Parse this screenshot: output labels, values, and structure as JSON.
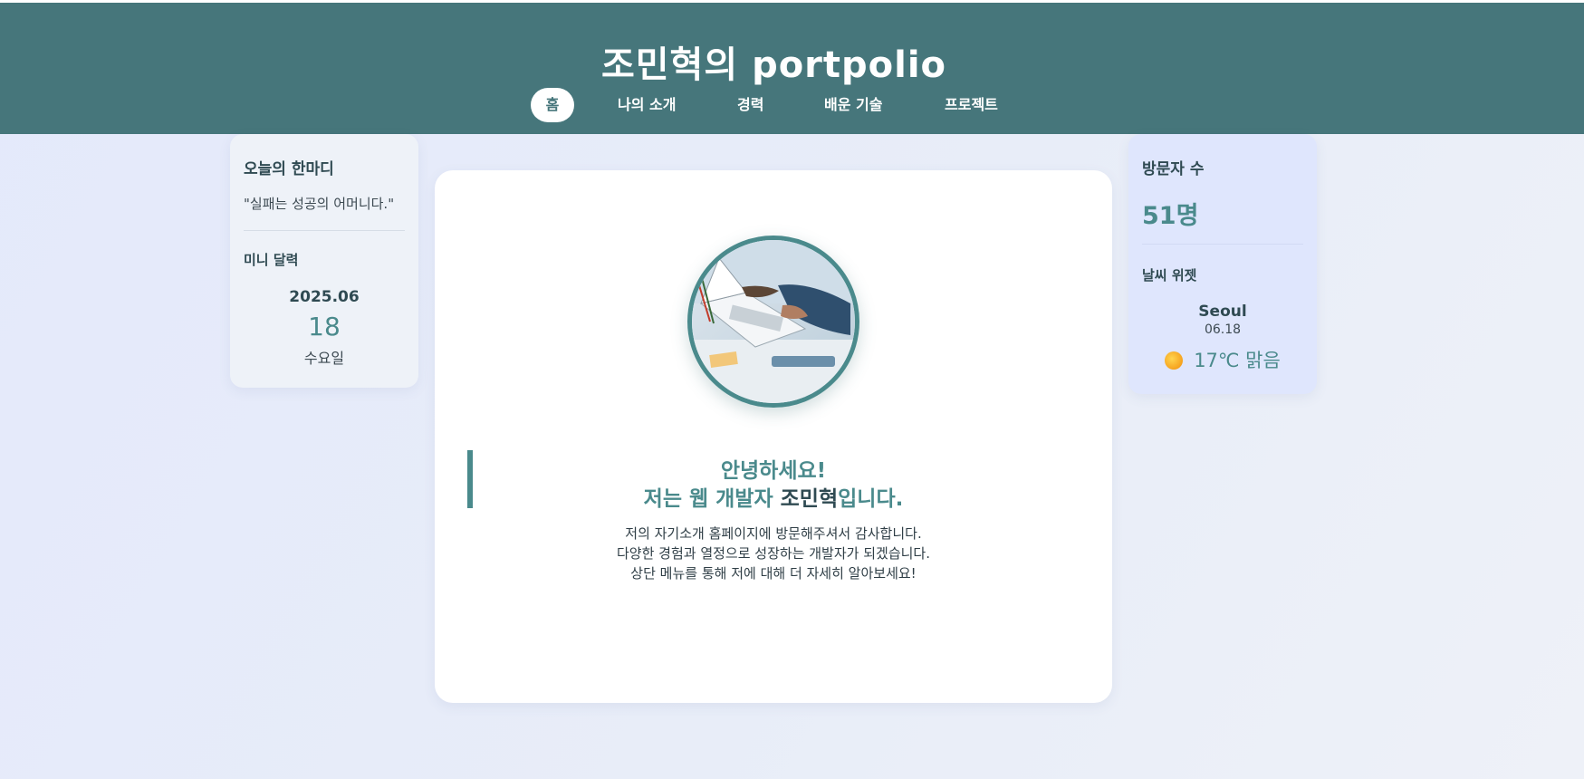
{
  "header": {
    "title": "조민혁의 portpolio",
    "nav": [
      {
        "label": "홈",
        "active": true
      },
      {
        "label": "나의 소개",
        "active": false
      },
      {
        "label": "경력",
        "active": false
      },
      {
        "label": "배운 기술",
        "active": false
      },
      {
        "label": "프로젝트",
        "active": false
      }
    ]
  },
  "left_panel": {
    "quote_title": "오늘의 한마디",
    "quote": "\"실패는 성공의 어머니다.\"",
    "calendar_title": "미니 달력",
    "calendar_month": "2025.06",
    "calendar_day": "18",
    "calendar_weekday": "수요일"
  },
  "main": {
    "greeting_line1": "안녕하세요!",
    "greeting_line2_prefix": "저는 웹 개발자 ",
    "greeting_name": "조민혁",
    "greeting_line2_suffix": "입니다.",
    "intro_lines": [
      "저의 자기소개 홈페이지에 방문해주셔서 감사합니다.",
      "다양한 경험과 열정으로 성장하는 개발자가 되겠습니다.",
      "상단 메뉴를 통해 저에 대해 더 자세히 알아보세요!"
    ]
  },
  "right_panel": {
    "visitor_title": "방문자 수",
    "visitor_count": "51명",
    "weather_title": "날씨 위젯",
    "city": "Seoul",
    "date": "06.18",
    "weather_icon": "sun-icon",
    "weather": "17℃ 맑음"
  },
  "colors": {
    "header_bg": "#46767b",
    "accent": "#4a8a8c",
    "page_bg": "#e6ebf9"
  }
}
